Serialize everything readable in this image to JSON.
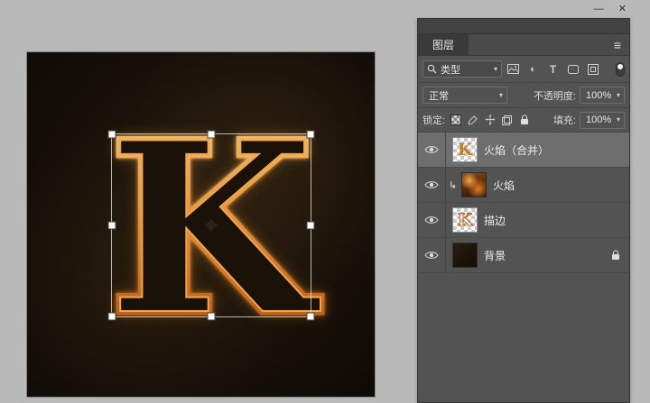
{
  "window": {
    "minimize_icon": "—",
    "close_icon": "✕"
  },
  "icons": {
    "minimize": "—",
    "close": "✕",
    "menu": "≡",
    "dropdown": "▾",
    "adjustment": "◐",
    "type": "T",
    "clip": "↳"
  },
  "canvas": {
    "letter": "K"
  },
  "panel": {
    "tab": "图层",
    "filter": {
      "kind_label": "类型"
    },
    "blend": {
      "mode": "正常",
      "opacity_label": "不透明度:",
      "opacity_value": "100%"
    },
    "lock": {
      "label": "锁定:",
      "fill_label": "填充:",
      "fill_value": "100%"
    },
    "layers": [
      {
        "name": "火焰（合并）",
        "selected": true,
        "visible": true,
        "thumb": "checker"
      },
      {
        "name": "火焰",
        "selected": false,
        "visible": true,
        "thumb": "fire",
        "clipped": true
      },
      {
        "name": "描边",
        "selected": false,
        "visible": true,
        "thumb": "checker"
      },
      {
        "name": "背景",
        "selected": false,
        "visible": true,
        "thumb": "dark",
        "locked": true
      }
    ]
  },
  "colors": {
    "fire_accent": "#e8953c",
    "canvas_background": "#17100a",
    "panel_background": "#535353",
    "selected_layer_highlight": "#6e6e6e"
  }
}
